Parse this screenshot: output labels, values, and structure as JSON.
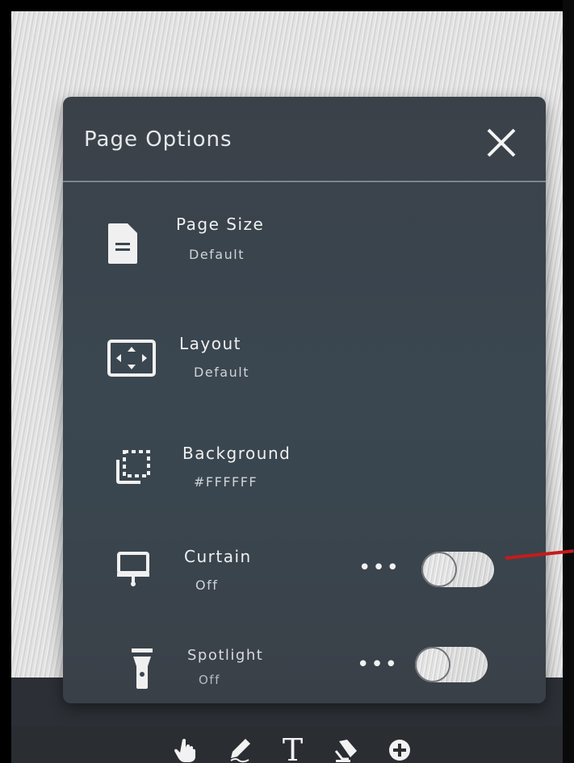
{
  "panel": {
    "title": "Page Options",
    "close_icon": "close-icon"
  },
  "options": [
    {
      "label": "Page Size",
      "value": "Default",
      "icon": "page-size-icon"
    },
    {
      "label": "Layout",
      "value": "Default",
      "icon": "layout-icon"
    },
    {
      "label": "Background",
      "value": "#FFFFFF",
      "icon": "background-icon"
    },
    {
      "label": "Curtain",
      "value": "Off",
      "icon": "curtain-icon",
      "more": "•••",
      "toggle": "off"
    },
    {
      "label": "Spotlight",
      "value": "Off",
      "icon": "spotlight-icon",
      "more": "•••",
      "toggle": "off"
    }
  ],
  "toolbar": {
    "tools": [
      "hand-icon",
      "pen-icon",
      "text-tool-icon",
      "eraser-icon",
      "add-icon"
    ],
    "text_tool_glyph": "T"
  },
  "colors": {
    "panel_bg": "#3a4650",
    "divider": "#8fa3b5",
    "toolbar_bg": "#2a2d32",
    "annotation_red": "#c41c1c"
  }
}
